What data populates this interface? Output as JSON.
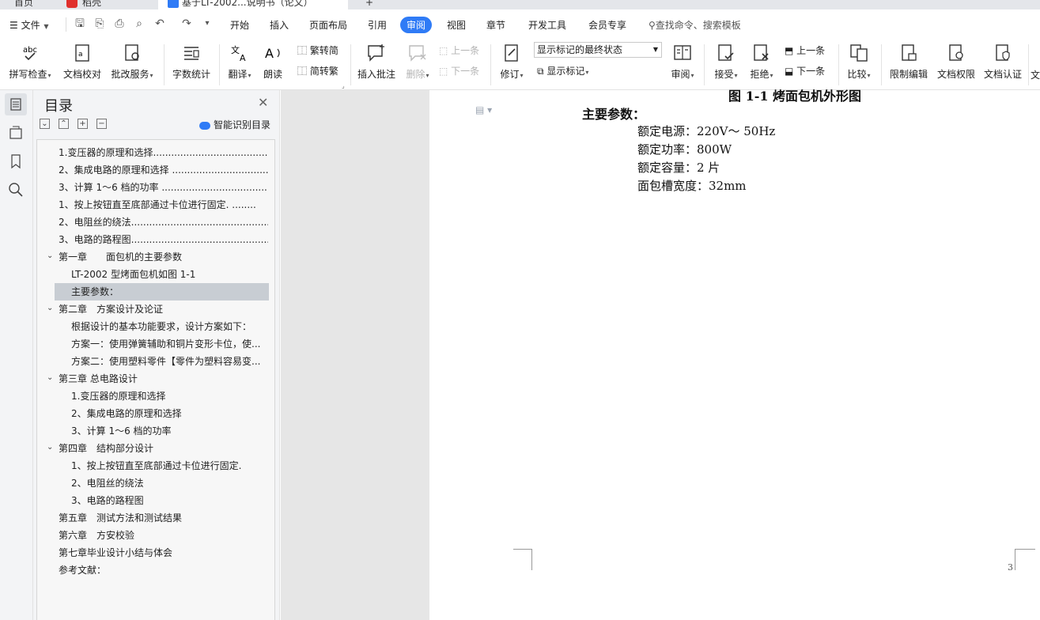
{
  "tabs": {
    "tab1": "首页",
    "tab2": "稻壳",
    "tab3": "基于LT-2002...说明书（论文）"
  },
  "menu": {
    "file": "文件",
    "items": [
      "开始",
      "插入",
      "页面布局",
      "引用",
      "审阅",
      "视图",
      "章节",
      "开发工具",
      "会员专享"
    ],
    "active": "审阅",
    "search_placeholder": "查找命令、搜索模板"
  },
  "ribbon": {
    "spell": "拼写检查",
    "proof": "文档校对",
    "review_service": "批改服务",
    "wordcount": "字数统计",
    "translate": "翻译",
    "read": "朗读",
    "trad": "繁转简",
    "simp": "简转繁",
    "insert_comment": "插入批注",
    "delete": "删除",
    "prev": "上一条",
    "next": "下一条",
    "track": "修订",
    "show_select": "显示标记的最终状态",
    "show_markup": "显示标记",
    "review": "审阅",
    "accept": "接受",
    "reject": "拒绝",
    "prev2": "上一条",
    "next2": "下一条",
    "compare": "比较",
    "restrict": "限制编辑",
    "rights": "文档权限",
    "cert": "文档认证",
    "more": "文"
  },
  "toc": {
    "title": "目录",
    "smart": "智能识别目录",
    "items": [
      "1.变压器的原理和选择.............................................",
      "2、集成电路的原理和选择 .....................................",
      "3、计算 1～6 档的功率 .........................................",
      "1、按上按钮直至底部通过卡位进行固定. ........",
      "2、电阻丝的绕法.....................................................",
      "3、电路的路程图.....................................................",
      "第一章　　面包机的主要参数",
      "LT-2002 型烤面包机如图 1-1",
      "主要参数：",
      "第二章　方案设计及论证",
      "根据设计的基本功能要求，设计方案如下：",
      "方案一：使用弹簧辅助和铜片变形卡位，使...",
      "方案二：使用塑料零件【零件为塑料容易变...",
      "第三章  总电路设计",
      "1.变压器的原理和选择",
      "2、集成电路的原理和选择",
      "3、计算 1～6 档的功率",
      "第四章　结构部分设计",
      "1、按上按钮直至底部通过卡位进行固定.",
      "2、电阻丝的绕法",
      "3、电路的路程图",
      "第五章　测试方法和测试结果",
      "第六章　方安校验",
      "第七章毕业设计小结与体会",
      "参考文献："
    ],
    "dots": "..."
  },
  "doc": {
    "figure_caption": "图 1-1 烤面包机外形图",
    "heading": "主要参数：",
    "lines": [
      "额定电源：220V～  50Hz",
      "额定功率：800W",
      "额定容量：2 片",
      "面包槽宽度：32mm"
    ],
    "page_number": "3"
  },
  "colors": {
    "accent": "#2f7bf6",
    "selected_row": "#c8cdd3",
    "panel_bg": "#f3f4f6"
  }
}
